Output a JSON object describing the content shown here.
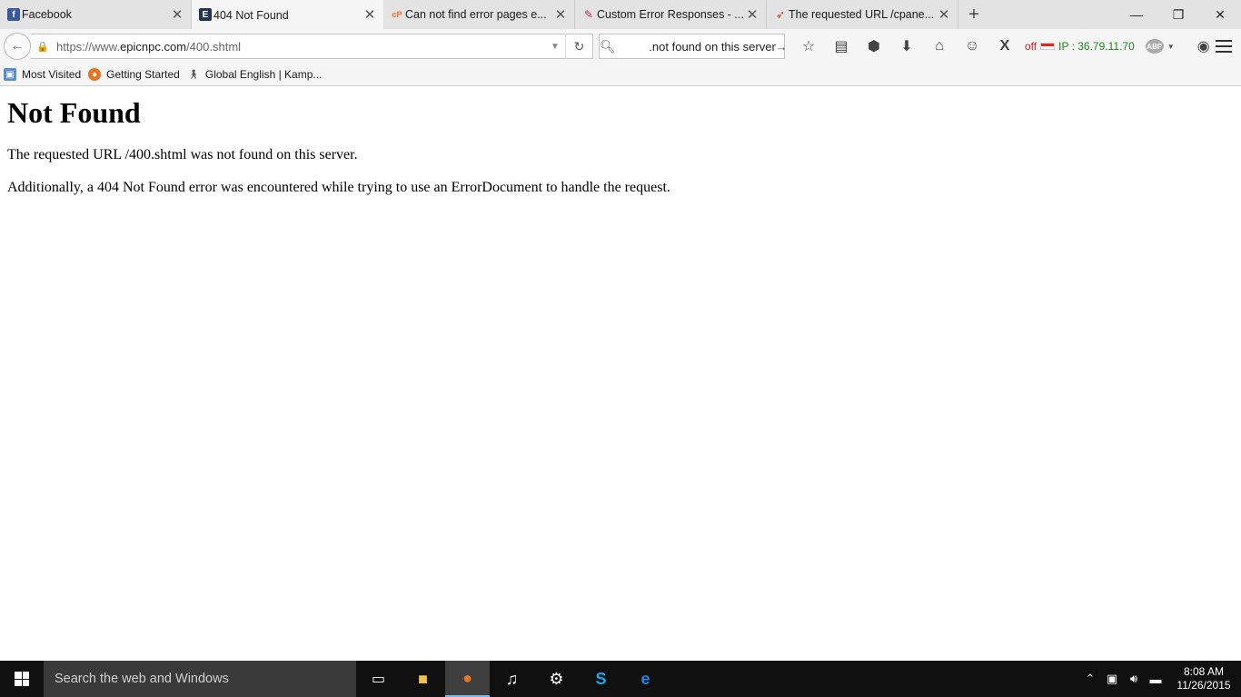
{
  "tabs": [
    {
      "title": "Facebook",
      "favicon": "f",
      "favicon_color": "#3b5998",
      "active": false
    },
    {
      "title": "404 Not Found",
      "favicon": "E",
      "favicon_color": "#223355",
      "active": true
    },
    {
      "title": "Can not find error pages e...",
      "favicon": "cP",
      "favicon_color": "#ff6c2c",
      "active": false
    },
    {
      "title": "Custom Error Responses - ...",
      "favicon": "✎",
      "favicon_color": "#c4245a",
      "active": false
    },
    {
      "title": "The requested URL /cpane...",
      "favicon": "➶",
      "favicon_color": "#d23a2a",
      "active": false
    }
  ],
  "urlbar": {
    "prefix": "https://www.",
    "domain": "epicnpc.com",
    "path": "/400.shtml"
  },
  "searchbar": {
    "value": "not found on this server."
  },
  "addons": {
    "off_label": "off",
    "ip_label": "IP : 36.79.11.70",
    "abp_label": "ABP"
  },
  "bookmarks": [
    {
      "label": "Most Visited"
    },
    {
      "label": "Getting Started"
    },
    {
      "label": "Global English | Kamp..."
    }
  ],
  "page": {
    "heading": "Not Found",
    "paragraph1": "The requested URL /400.shtml was not found on this server.",
    "paragraph2": "Additionally, a 404 Not Found error was encountered while trying to use an ErrorDocument to handle the request."
  },
  "taskbar": {
    "search_placeholder": "Search the web and Windows",
    "time": "8:08 AM",
    "date": "11/26/2015"
  }
}
